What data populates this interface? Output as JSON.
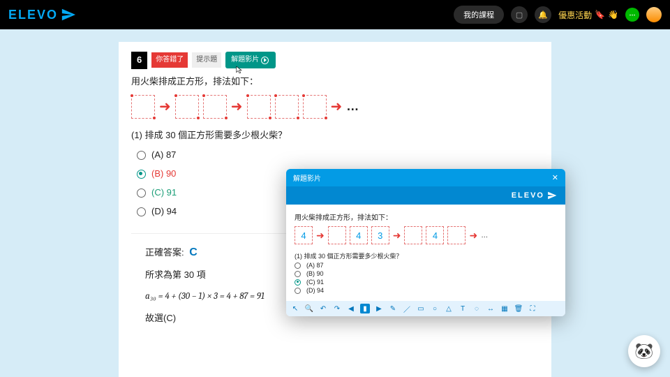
{
  "brand": "ELEVO",
  "nav": {
    "my_courses": "我的課程",
    "promo": "優惠活動"
  },
  "question": {
    "number": "6",
    "wrong_label": "你答錯了",
    "retry_label": "提示題",
    "explain_btn": "解題影片",
    "stem": "用火柴排成正方形，排法如下：",
    "sub": "(1) 排成 30 個正方形需要多少根火柴？",
    "dots": "…",
    "options": [
      {
        "key": "A",
        "text": "(A) 87",
        "cls": ""
      },
      {
        "key": "B",
        "text": "(B) 90",
        "cls": "red",
        "selected": true
      },
      {
        "key": "C",
        "text": "(C) 91",
        "cls": "green"
      },
      {
        "key": "D",
        "text": "(D) 94",
        "cls": ""
      }
    ]
  },
  "answer": {
    "label": "正確答案:",
    "letter": "C",
    "line1": "所求為第 30 項",
    "formula": "a₃₀ = 4 + (30 − 1) × 3 = 4 + 87 = 91",
    "line2": "故選(C)"
  },
  "modal": {
    "title": "解題影片",
    "brand": "ELEVO",
    "stem": "用火柴排成正方形，排法如下：",
    "sq_vals": [
      "4",
      "",
      "4",
      "3",
      "",
      "4",
      ""
    ],
    "sub": "(1) 排成 30 個正方形需要多少根火柴？",
    "options": [
      {
        "text": "(A) 87"
      },
      {
        "text": "(B) 90"
      },
      {
        "text": "(C) 91",
        "selected": true
      },
      {
        "text": "(D) 94"
      }
    ]
  }
}
